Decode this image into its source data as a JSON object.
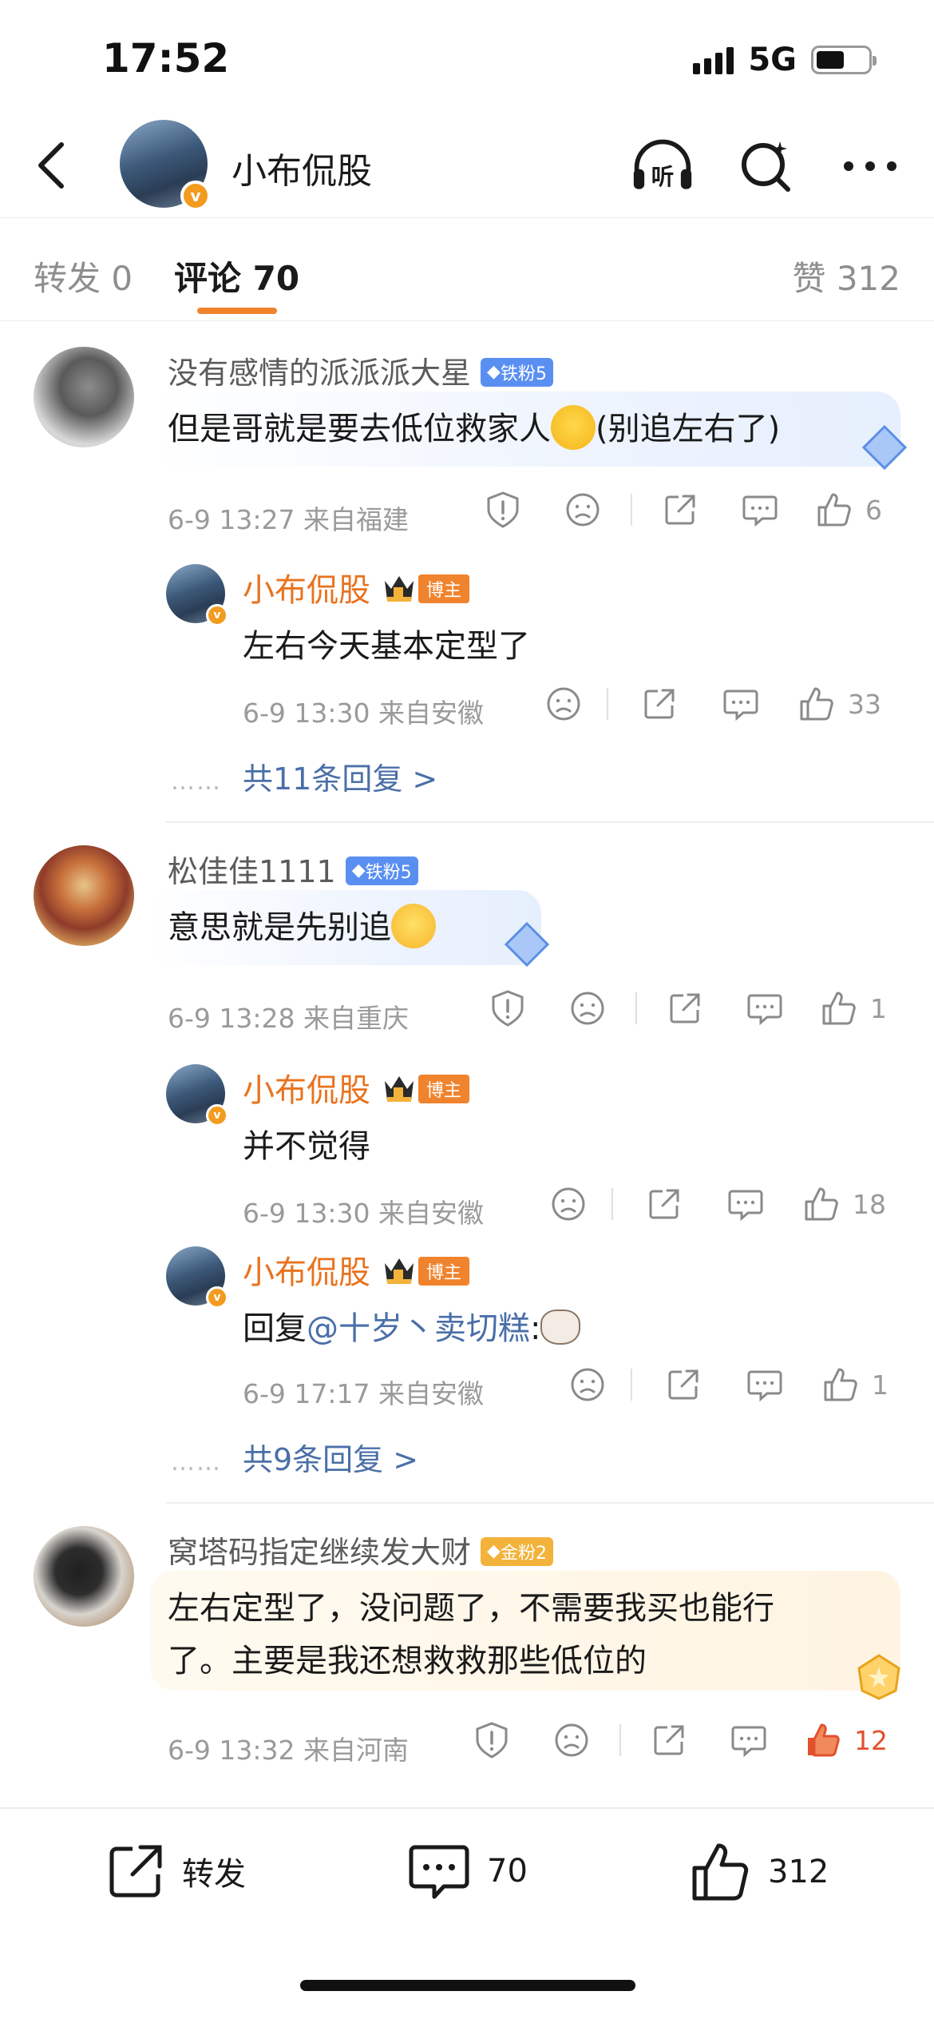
{
  "status_bar": {
    "time": "17:52",
    "network": "5G"
  },
  "header": {
    "title": "小布侃股",
    "listen_label": "听"
  },
  "tabs": {
    "repost": "转发 0",
    "comments": "评论 70",
    "likes": "赞 312"
  },
  "comments": [
    {
      "username": "没有感情的派派派大星",
      "badge": "铁粉5",
      "text": "但是哥就是要去低位救家人",
      "text_suffix": "(别追左右了)",
      "meta": "6-9 13:27  来自福建",
      "likes": "6",
      "replies": [
        {
          "username": "小布侃股",
          "owner_badge": "博主",
          "text": "左右今天基本定型了",
          "meta": "6-9 13:30  来自安徽",
          "likes": "33"
        }
      ],
      "more_replies": "共11条回复 >"
    },
    {
      "username": "松佳佳1111",
      "badge": "铁粉5",
      "text": "意思就是先别追",
      "meta": "6-9 13:28  来自重庆",
      "likes": "1",
      "replies": [
        {
          "username": "小布侃股",
          "owner_badge": "博主",
          "text": "并不觉得",
          "meta": "6-9 13:30  来自安徽",
          "likes": "18"
        },
        {
          "username": "小布侃股",
          "owner_badge": "博主",
          "text_prefix": "回复",
          "mention": "@十岁丶卖切糕",
          "text_colon": ":",
          "meta": "6-9 17:17  来自安徽",
          "likes": "1"
        }
      ],
      "more_replies": "共9条回复 >"
    },
    {
      "username": "窝塔码指定继续发大财",
      "badge": "金粉2",
      "text_line1": "左右定型了，没问题了，不需要我买也能行",
      "text_line2": "了。主要是我还想救救那些低位的",
      "meta": "6-9 13:32  来自河南",
      "likes": "12"
    }
  ],
  "bottom_bar": {
    "repost_label": "转发",
    "comment_count": "70",
    "like_count": "312"
  },
  "colors": {
    "accent": "#f0832d",
    "link": "#4a6fa8",
    "liked": "#e2512d"
  }
}
